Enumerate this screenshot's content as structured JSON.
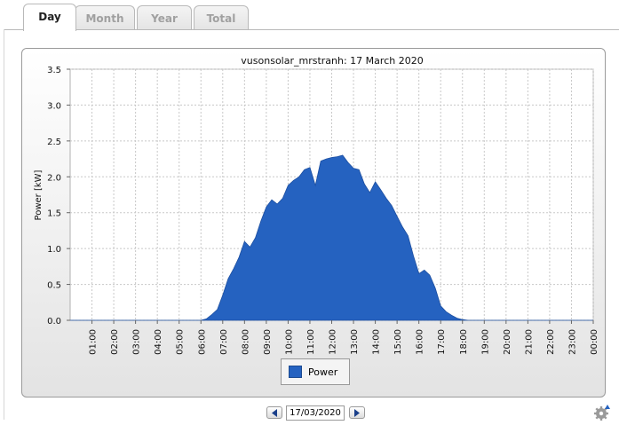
{
  "tabs": [
    {
      "label": "Day",
      "active": true
    },
    {
      "label": "Month",
      "active": false
    },
    {
      "label": "Year",
      "active": false
    },
    {
      "label": "Total",
      "active": false
    }
  ],
  "date_nav": {
    "date_value": "17/03/2020",
    "prev_icon": "triangle-left-icon",
    "next_icon": "triangle-right-icon"
  },
  "settings_icon": "gear-icon",
  "colors": {
    "series": "#2562c0",
    "accent_tab_text": "#222222"
  },
  "chart_data": {
    "type": "area",
    "title": "vusonsolar_mrstranh: 17 March 2020",
    "xlabel": "",
    "ylabel": "Power [kW]",
    "ylim": [
      0,
      3.5
    ],
    "yticks": [
      "0.0",
      "0.5",
      "1.0",
      "1.5",
      "2.0",
      "2.5",
      "3.0",
      "3.5"
    ],
    "xlim_hours": [
      0,
      24
    ],
    "xticks": [
      "01:00",
      "02:00",
      "03:00",
      "04:00",
      "05:00",
      "06:00",
      "07:00",
      "08:00",
      "09:00",
      "10:00",
      "11:00",
      "12:00",
      "13:00",
      "14:00",
      "15:00",
      "16:00",
      "17:00",
      "18:00",
      "19:00",
      "20:00",
      "21:00",
      "22:00",
      "23:00",
      "00:00"
    ],
    "grid": true,
    "legend_position": "bottom",
    "series": [
      {
        "name": "Power",
        "color": "#2562c0",
        "x": [
          0,
          6.0,
          6.25,
          6.5,
          6.75,
          7.0,
          7.25,
          7.5,
          7.75,
          8.0,
          8.25,
          8.5,
          8.75,
          9.0,
          9.25,
          9.5,
          9.75,
          10.0,
          10.25,
          10.5,
          10.75,
          11.0,
          11.25,
          11.5,
          11.75,
          12.0,
          12.25,
          12.5,
          12.75,
          13.0,
          13.25,
          13.5,
          13.75,
          14.0,
          14.25,
          14.5,
          14.75,
          15.0,
          15.25,
          15.5,
          15.75,
          16.0,
          16.25,
          16.5,
          16.75,
          17.0,
          17.25,
          17.5,
          17.75,
          18.0,
          18.25,
          24
        ],
        "y": [
          0,
          0,
          0.02,
          0.08,
          0.15,
          0.35,
          0.58,
          0.72,
          0.88,
          1.1,
          1.02,
          1.15,
          1.38,
          1.58,
          1.68,
          1.62,
          1.7,
          1.88,
          1.95,
          2.0,
          2.1,
          2.13,
          1.88,
          2.22,
          2.25,
          2.27,
          2.28,
          2.3,
          2.2,
          2.12,
          2.1,
          1.9,
          1.78,
          1.93,
          1.82,
          1.7,
          1.6,
          1.45,
          1.3,
          1.18,
          0.9,
          0.65,
          0.7,
          0.63,
          0.45,
          0.2,
          0.12,
          0.07,
          0.03,
          0.01,
          0,
          0
        ]
      }
    ]
  }
}
